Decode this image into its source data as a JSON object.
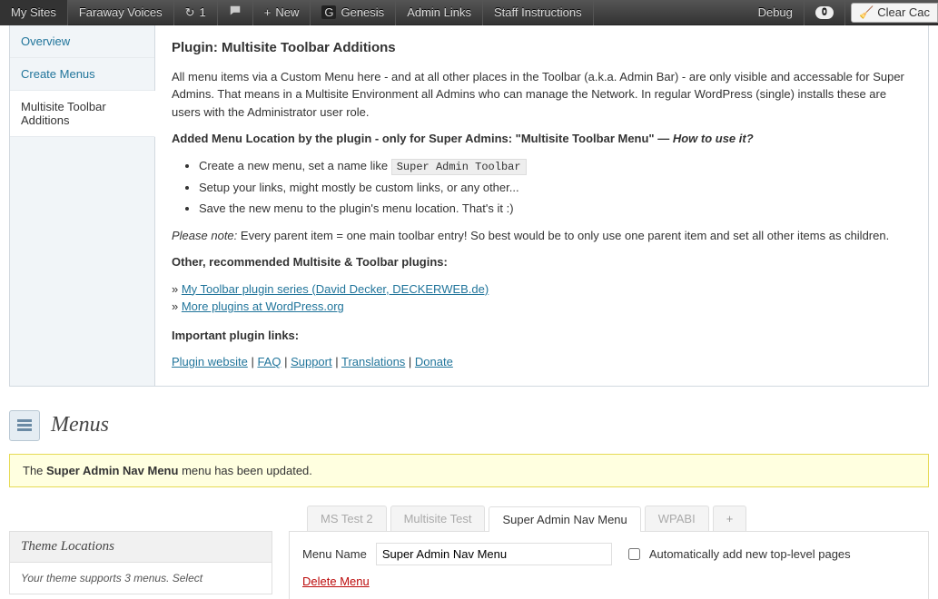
{
  "admin_bar": {
    "my_sites": "My Sites",
    "site_name": "Faraway Voices",
    "updates": "1",
    "new": "New",
    "genesis": "Genesis",
    "admin_links": "Admin Links",
    "staff_instructions": "Staff Instructions",
    "debug": "Debug",
    "debug_count": "0",
    "clear_cache": "Clear Cac"
  },
  "help_tabs": {
    "overview": "Overview",
    "create_menus": "Create Menus",
    "multisite_toolbar": "Multisite Toolbar Additions"
  },
  "help": {
    "title": "Plugin: Multisite Toolbar Additions",
    "intro": "All menu items via a Custom Menu here - and at all other places in the Toolbar (a.k.a. Admin Bar) - are only visible and accessable for Super Admins. That means in a Multisite Environment all Admins who can manage the Network. In regular WordPress (single) installs these are users with the Administrator user role.",
    "added_loc_prefix": "Added Menu Location by the plugin - only for Super Admins: \"Multisite Toolbar Menu\" — ",
    "added_loc_em": "How to use it?",
    "li1_prefix": "Create a new menu, set a name like ",
    "li1_code": "Super Admin Toolbar",
    "li2": "Setup your links, might mostly be custom links, or any other...",
    "li3": "Save the new menu to the plugin's menu location. That's it :)",
    "note_em": "Please note:",
    "note_rest": " Every parent item = one main toolbar entry! So best would be to only use one parent item and set all other items as children.",
    "other_h": "Other, recommended Multisite & Toolbar plugins:",
    "raquo": "» ",
    "series_link": "My Toolbar plugin series (David Decker, DECKERWEB.de)",
    "more_link": "More plugins at WordPress.org",
    "important_h": "Important plugin links:",
    "l_website": "Plugin website",
    "l_faq": "FAQ",
    "l_support": "Support",
    "l_translations": "Translations",
    "l_donate": "Donate",
    "sep": " | "
  },
  "page": {
    "heading": "Menus",
    "notice_prefix": "The ",
    "notice_strong": "Super Admin Nav Menu",
    "notice_suffix": " menu has been updated."
  },
  "theme_loc": {
    "title": "Theme Locations",
    "desc": "Your theme supports 3 menus. Select"
  },
  "tabs": {
    "t1": "MS Test 2",
    "t2": "Multisite Test",
    "t3": "Super Admin Nav Menu",
    "t4": "WPABI",
    "add": "+"
  },
  "menu_edit": {
    "name_label": "Menu Name",
    "name_value": "Super Admin Nav Menu",
    "auto_add": "Automatically add new top-level pages",
    "delete": "Delete Menu"
  }
}
